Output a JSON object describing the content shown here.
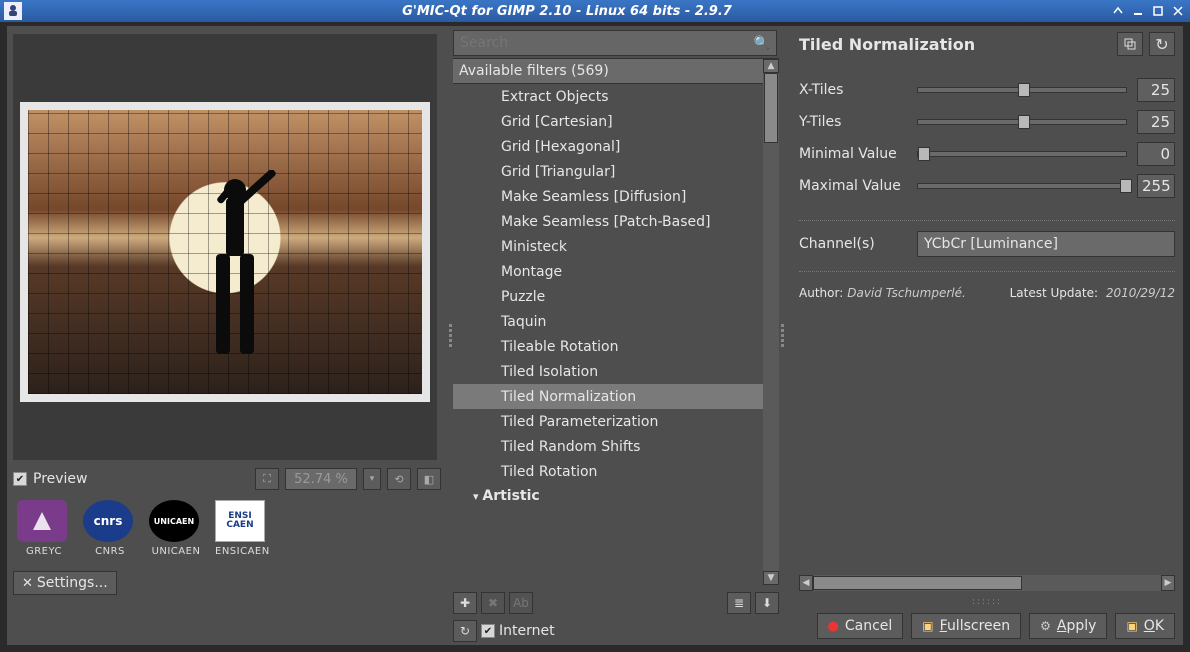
{
  "window": {
    "title": "G'MIC-Qt for GIMP 2.10 - Linux 64 bits - 2.9.7"
  },
  "preview": {
    "checkbox_label": "Preview",
    "checked": true,
    "zoom_pct": "52.74 %"
  },
  "sponsors": [
    {
      "key": "greyc",
      "label": "GREYC",
      "logo_text": ""
    },
    {
      "key": "cnrs",
      "label": "CNRS",
      "logo_text": "cnrs"
    },
    {
      "key": "unicaen",
      "label": "UNICAEN",
      "logo_text": "UNICAEN"
    },
    {
      "key": "ensi",
      "label": "ENSICAEN",
      "logo_text": "ENSI\nCAEN"
    }
  ],
  "settings_btn": "Settings...",
  "search": {
    "placeholder": "Search"
  },
  "filters": {
    "header": "Available filters (569)",
    "items": [
      "Extract Objects",
      "Grid [Cartesian]",
      "Grid [Hexagonal]",
      "Grid [Triangular]",
      "Make Seamless [Diffusion]",
      "Make Seamless [Patch-Based]",
      "Ministeck",
      "Montage",
      "Puzzle",
      "Taquin",
      "Tileable Rotation",
      "Tiled Isolation",
      "Tiled Normalization",
      "Tiled Parameterization",
      "Tiled Random Shifts",
      "Tiled Rotation"
    ],
    "selected_index": 12,
    "next_category": "Artistic"
  },
  "internet": {
    "label": "Internet",
    "checked": true
  },
  "current_filter": {
    "title": "Tiled Normalization",
    "params": [
      {
        "label": "X-Tiles",
        "value": "25",
        "knob_pct": 48
      },
      {
        "label": "Y-Tiles",
        "value": "25",
        "knob_pct": 48
      },
      {
        "label": "Minimal Value",
        "value": "0",
        "knob_pct": 0
      },
      {
        "label": "Maximal Value",
        "value": "255",
        "knob_pct": 97
      }
    ],
    "channel_label": "Channel(s)",
    "channel_value": "YCbCr [Luminance]",
    "author_label": "Author:",
    "author_value": "David Tschumperlé.",
    "update_label": "Latest Update:",
    "update_value": "2010/29/12"
  },
  "buttons": {
    "cancel": "Cancel",
    "fullscreen": "Fullscreen",
    "apply": "Apply",
    "ok": "OK"
  }
}
